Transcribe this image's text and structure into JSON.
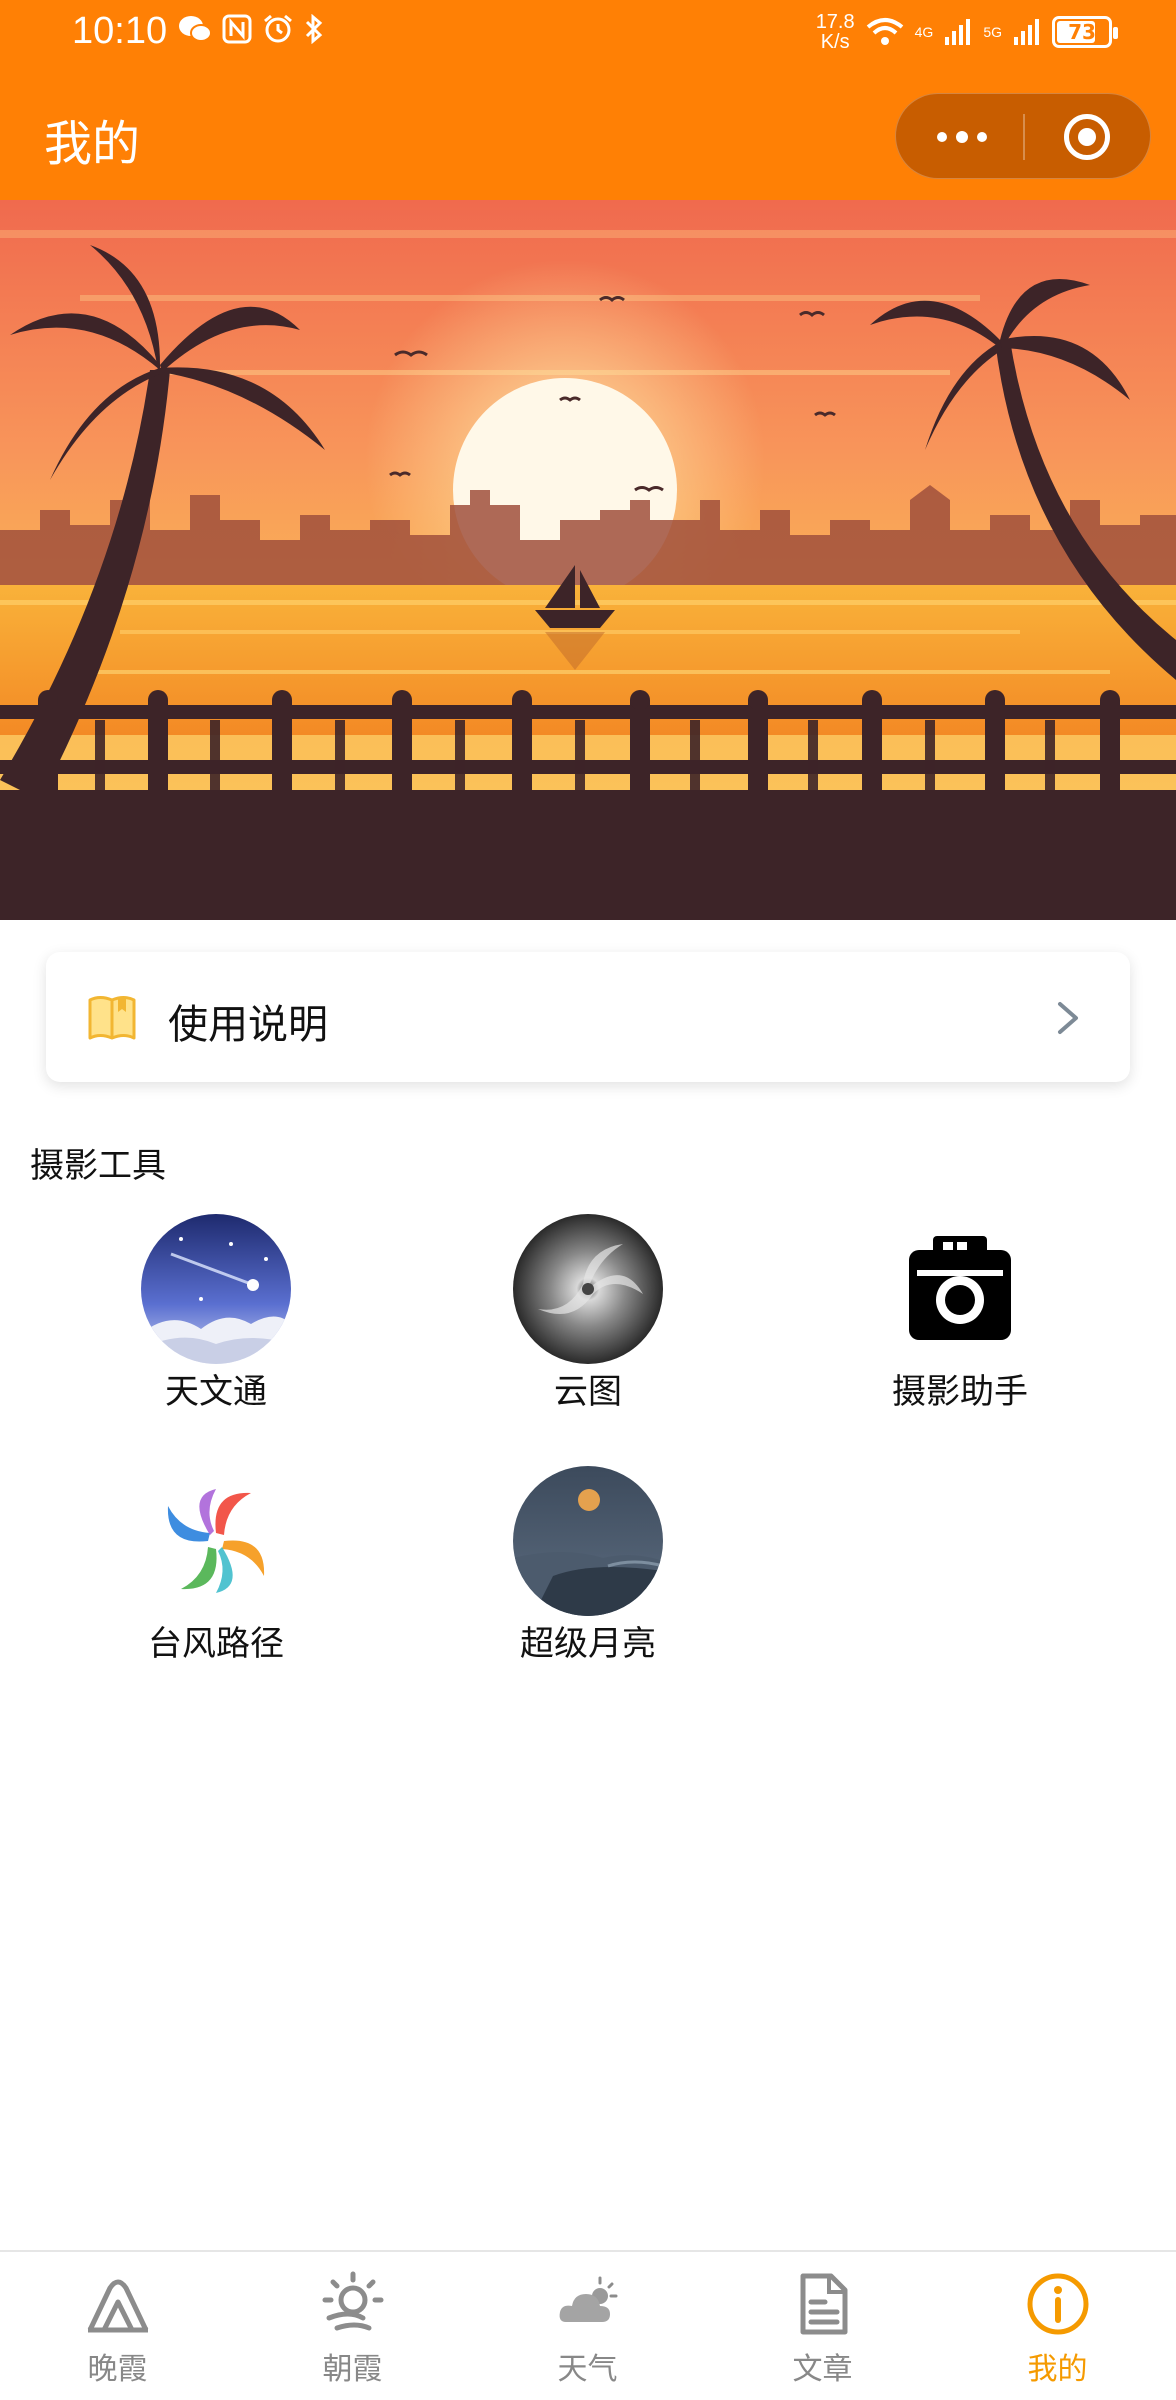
{
  "status_bar": {
    "time": "10:10",
    "net_speed_value": "17.8",
    "net_speed_unit": "K/s",
    "signal_1": "4G",
    "signal_2": "5G",
    "battery": "73"
  },
  "header": {
    "title": "我的",
    "menu_icon": "more-dots-icon",
    "close_icon": "mini-program-close-icon",
    "color": "#ff8005"
  },
  "banner": {
    "scene": "sunset-harbor-illustration"
  },
  "instructions": {
    "label": "使用说明",
    "icon": "book-icon"
  },
  "tools_section": {
    "title": "摄影工具",
    "items": [
      {
        "label": "天文通",
        "icon": "meteor-sky-icon"
      },
      {
        "label": "云图",
        "icon": "typhoon-satellite-icon"
      },
      {
        "label": "摄影助手",
        "icon": "camera-icon"
      },
      {
        "label": "台风路径",
        "icon": "colorful-swirl-icon"
      },
      {
        "label": "超级月亮",
        "icon": "moon-over-sea-icon"
      }
    ]
  },
  "tabbar": {
    "active_color": "#f59a00",
    "inactive_color": "#888888",
    "items": [
      {
        "label": "晚霞",
        "icon": "mountain-icon"
      },
      {
        "label": "朝霞",
        "icon": "sunrise-icon"
      },
      {
        "label": "天气",
        "icon": "cloud-icon"
      },
      {
        "label": "文章",
        "icon": "document-icon"
      },
      {
        "label": "我的",
        "icon": "info-icon"
      }
    ],
    "active_index": 4
  }
}
